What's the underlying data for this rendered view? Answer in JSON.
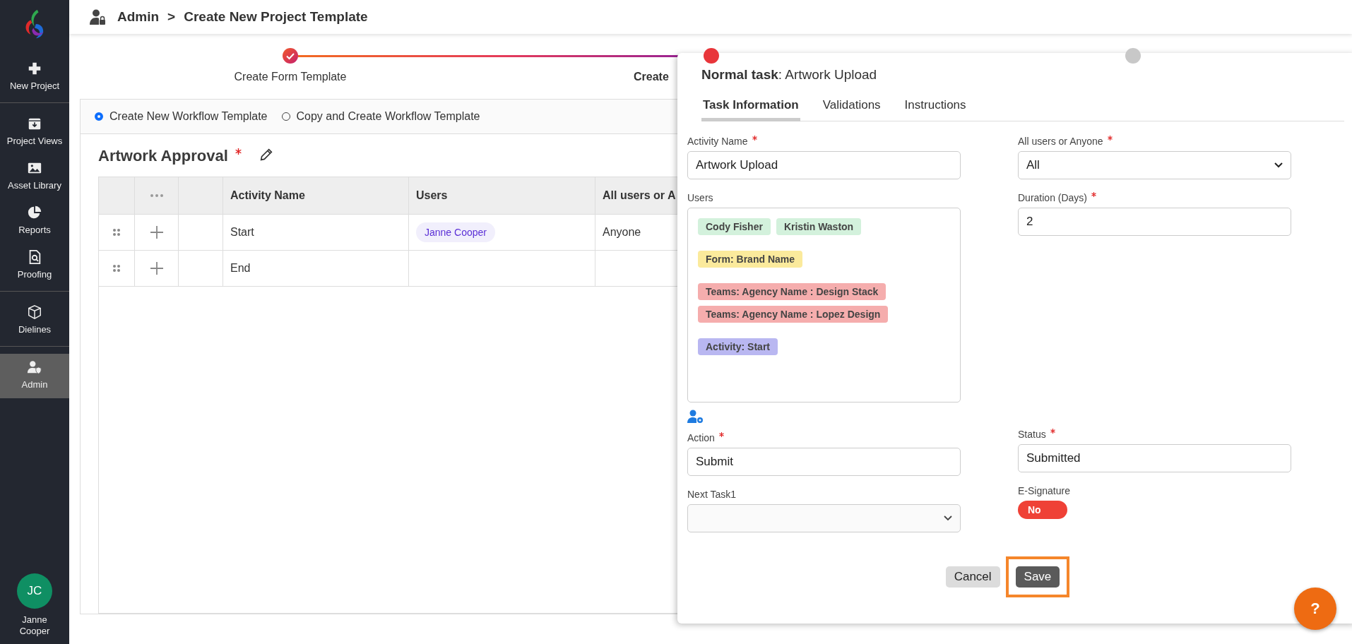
{
  "sidebar": {
    "items": [
      {
        "label": "New Project",
        "selected": false,
        "divider_after": true
      },
      {
        "label": "Project Views",
        "selected": false,
        "divider_after": false
      },
      {
        "label": "Asset Library",
        "selected": false,
        "divider_after": false
      },
      {
        "label": "Reports",
        "selected": false,
        "divider_after": false
      },
      {
        "label": "Proofing",
        "selected": false,
        "divider_after": true
      },
      {
        "label": "Dielines",
        "selected": false,
        "divider_after": true
      },
      {
        "label": "Admin",
        "selected": true,
        "divider_after": false
      }
    ],
    "user": {
      "initials": "JC",
      "name": "Janne Cooper"
    }
  },
  "breadcrumb": {
    "items": [
      "Admin",
      "Create New Project Template"
    ],
    "separator": ">"
  },
  "stepper": {
    "steps": [
      {
        "label": "Create Form Template",
        "kind": "done"
      },
      {
        "label": "Create",
        "kind": "current"
      },
      {
        "kind": "pending"
      }
    ]
  },
  "workflow": {
    "options": [
      {
        "label": "Create New Workflow Template",
        "selected": true
      },
      {
        "label": "Copy and Create Workflow Template",
        "selected": false
      }
    ],
    "title": "Artwork Approval",
    "title_required": true,
    "table": {
      "columns": [
        "Activity Name",
        "Users",
        "All users or A"
      ],
      "rows": [
        {
          "activity": "Start",
          "users": [
            "Janne Cooper"
          ],
          "mode": "Anyone"
        },
        {
          "activity": "End",
          "users": [],
          "mode": ""
        }
      ]
    }
  },
  "panel": {
    "title": "**Normal task**: Artwork Upload",
    "tabs": [
      {
        "label": "Task Information",
        "selected": true
      },
      {
        "label": "Validations",
        "selected": false
      },
      {
        "label": "Instructions",
        "selected": false
      }
    ],
    "activity_name": {
      "label": "Activity Name",
      "required": true,
      "value": "Artwork Upload"
    },
    "all_users": {
      "label": "All users or Anyone",
      "required": true,
      "value": "All"
    },
    "users": {
      "label": "Users",
      "tags": [
        {
          "label": "Cody Fisher",
          "kind": "user"
        },
        {
          "label": "Kristin Waston",
          "kind": "user"
        },
        {
          "label": "Form: Brand Name",
          "kind": "form"
        },
        {
          "label": "Teams: Agency Name : Design Stack",
          "kind": "team"
        },
        {
          "label": "Teams: Agency Name : Lopez Design",
          "kind": "team"
        },
        {
          "label": "Activity: Start",
          "kind": "activity"
        }
      ]
    },
    "duration": {
      "label": "Duration (Days)",
      "required": true,
      "value": "2"
    },
    "action": {
      "label": "Action",
      "required": true,
      "value": "Submit"
    },
    "status": {
      "label": "Status",
      "required": true,
      "value": "Submitted"
    },
    "next_task": {
      "label": "Next Task1"
    },
    "esignature": {
      "label": "E-Signature",
      "on": false,
      "value": "No"
    },
    "buttons": [
      {
        "label": "Cancel",
        "kind": "secondary",
        "highlighted": false
      },
      {
        "label": "Save",
        "kind": "primary",
        "highlighted": true
      }
    ]
  },
  "help": {
    "label": "?"
  }
}
